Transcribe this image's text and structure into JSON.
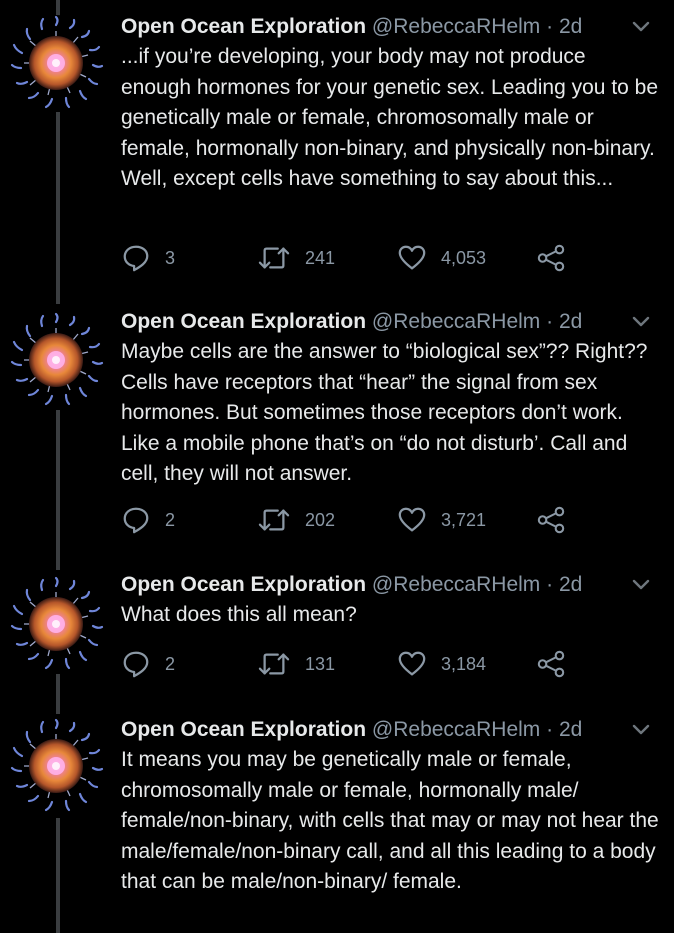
{
  "colors": {
    "background": "#000000",
    "text": "#e7e9ea",
    "muted": "#8b98a5",
    "thread_line": "#3a3d40"
  },
  "tweets": [
    {
      "author_name": "Open Ocean Exploration",
      "author_handle": "@RebeccaRHelm",
      "separator": "·",
      "time": "2d",
      "text": "...if you’re developing, your body may not produce enough hormones for your genetic sex. Leading you to be genetically male or female, chromosomally male or female, hormonally non-binary, and physically non-binary. Well, except cells have something to say about this...",
      "replies": "3",
      "retweets": "241",
      "likes": "4,053"
    },
    {
      "author_name": "Open Ocean Exploration",
      "author_handle": "@RebeccaRHelm",
      "separator": "·",
      "time": "2d",
      "text": "Maybe cells are the answer to “biological sex”?? Right?? Cells have receptors that “hear” the signal from sex hormones. But sometimes those receptors don’t work. Like a mobile phone that’s on “do not disturb’. Call and cell, they will not answer.",
      "replies": "2",
      "retweets": "202",
      "likes": "3,721"
    },
    {
      "author_name": "Open Ocean Exploration",
      "author_handle": "@RebeccaRHelm",
      "separator": "·",
      "time": "2d",
      "text": "What does this all mean?",
      "replies": "2",
      "retweets": "131",
      "likes": "3,184"
    },
    {
      "author_name": "Open Ocean Exploration",
      "author_handle": "@RebeccaRHelm",
      "separator": "·",
      "time": "2d",
      "text": "It means you may be genetically male or female, chromosomally male or female, hormonally male/ female/non-binary, with cells that may or may not hear the male/female/non-binary call, and all this leading to a body that can be male/non-binary/ female."
    }
  ],
  "icons": {
    "avatar": "jellyfish-avatar",
    "caret": "chevron-down-icon",
    "reply": "reply-icon",
    "retweet": "retweet-icon",
    "like": "heart-icon",
    "share": "share-icon"
  }
}
